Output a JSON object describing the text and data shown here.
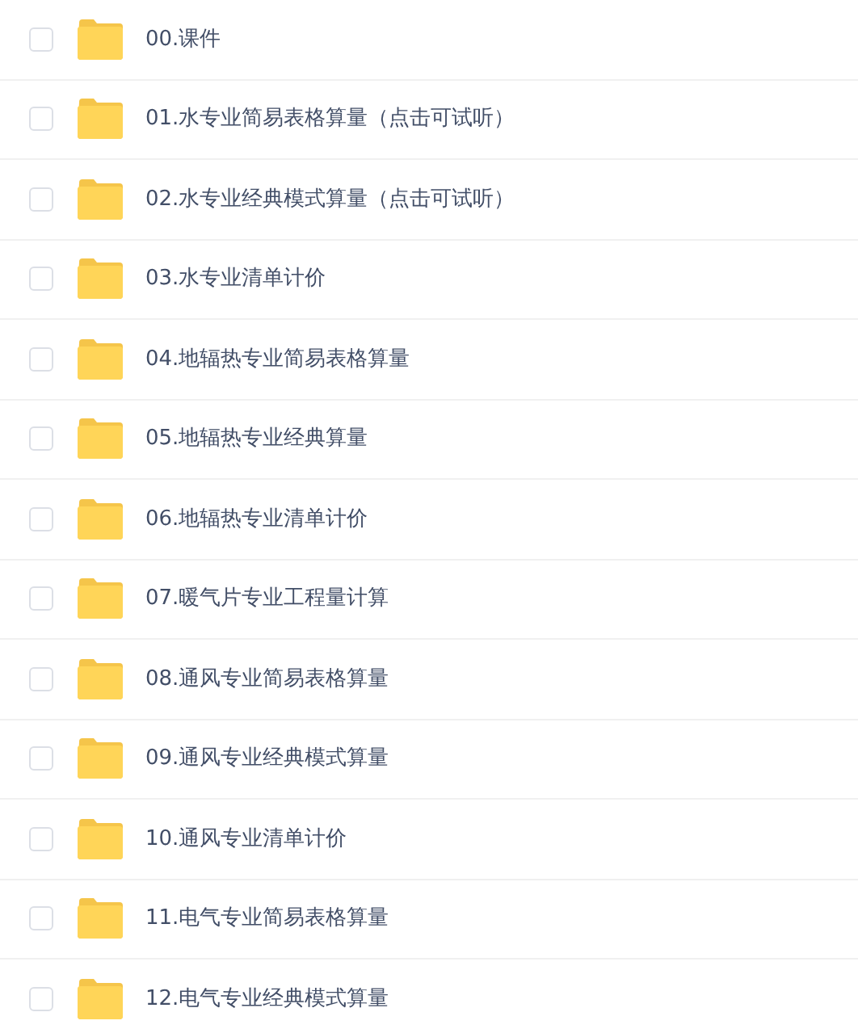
{
  "files": [
    {
      "name": "00.课件",
      "checked": false
    },
    {
      "name": "01.水专业简易表格算量（点击可试听）",
      "checked": false
    },
    {
      "name": "02.水专业经典模式算量（点击可试听）",
      "checked": false
    },
    {
      "name": "03.水专业清单计价",
      "checked": false
    },
    {
      "name": "04.地辐热专业简易表格算量",
      "checked": false
    },
    {
      "name": "05.地辐热专业经典算量",
      "checked": false
    },
    {
      "name": "06.地辐热专业清单计价",
      "checked": false
    },
    {
      "name": "07.暖气片专业工程量计算",
      "checked": false
    },
    {
      "name": "08.通风专业简易表格算量",
      "checked": false
    },
    {
      "name": "09.通风专业经典模式算量",
      "checked": false
    },
    {
      "name": "10.通风专业清单计价",
      "checked": false
    },
    {
      "name": "11.电气专业简易表格算量",
      "checked": false
    },
    {
      "name": "12.电气专业经典模式算量",
      "checked": false
    }
  ]
}
